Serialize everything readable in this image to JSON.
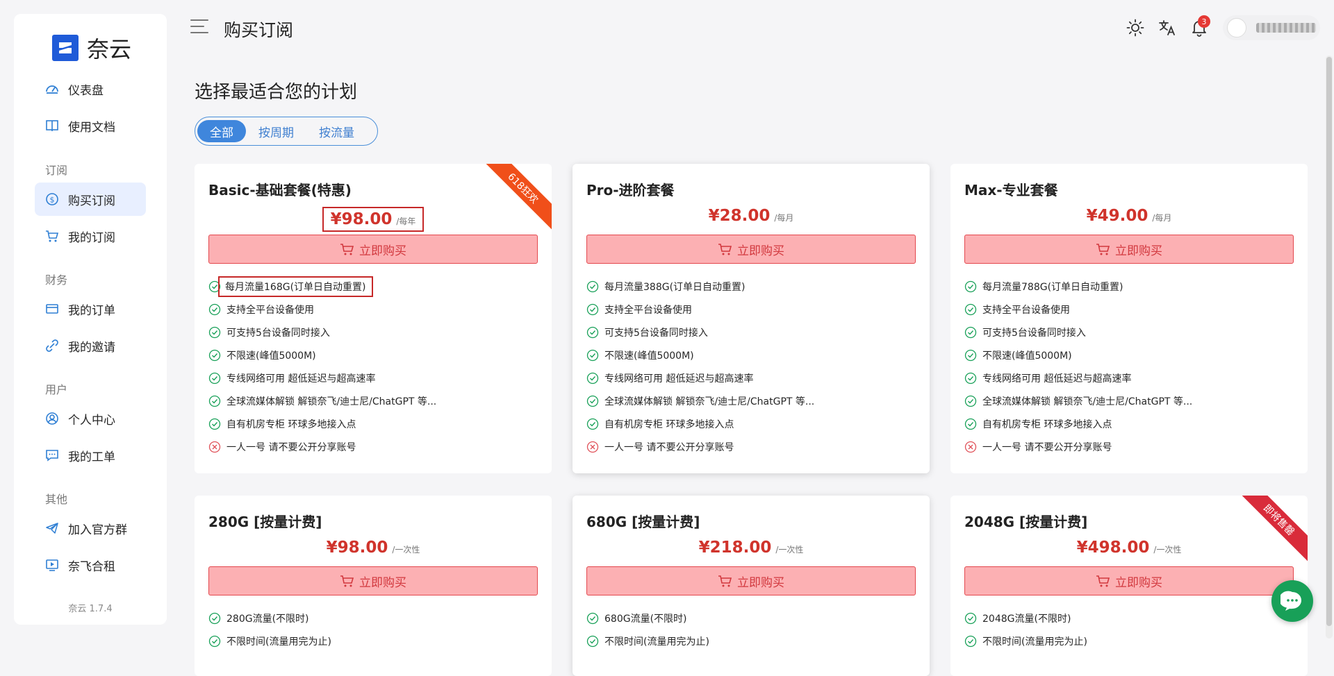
{
  "app": {
    "name": "奈云",
    "version": "奈云 1.7.4"
  },
  "sidebar": {
    "items": [
      {
        "label": "仪表盘",
        "icon": "dashboard-icon"
      },
      {
        "label": "使用文档",
        "icon": "book-icon"
      },
      {
        "group": "订阅"
      },
      {
        "label": "购买订阅",
        "icon": "dollar-icon",
        "active": true
      },
      {
        "label": "我的订阅",
        "icon": "cart-icon"
      },
      {
        "group": "财务"
      },
      {
        "label": "我的订单",
        "icon": "wallet-icon"
      },
      {
        "label": "我的邀请",
        "icon": "share-icon"
      },
      {
        "group": "用户"
      },
      {
        "label": "个人中心",
        "icon": "user-icon"
      },
      {
        "label": "我的工单",
        "icon": "chat-icon"
      },
      {
        "group": "其他"
      },
      {
        "label": "加入官方群",
        "icon": "telegram-icon"
      },
      {
        "label": "奈飞合租",
        "icon": "video-icon"
      }
    ]
  },
  "header": {
    "title": "购买订阅",
    "notification_count": "3"
  },
  "main": {
    "heading": "选择最适合您的计划",
    "tabs": [
      {
        "label": "全部",
        "active": true
      },
      {
        "label": "按周期"
      },
      {
        "label": "按流量"
      }
    ],
    "buy_label": "立即购买",
    "plans": [
      {
        "title": "Basic-基础套餐(特惠)",
        "price": "¥98.00",
        "period": "/每年",
        "ribbon": "618狂欢",
        "features": [
          {
            "text": "每月流量168G(订单日自动重置)",
            "ok": true
          },
          {
            "text": "支持全平台设备使用",
            "ok": true
          },
          {
            "text": "可支持5台设备同时接入",
            "ok": true
          },
          {
            "text": "不限速(峰值5000M)",
            "ok": true
          },
          {
            "text": "专线网络可用 超低延迟与超高速率",
            "ok": true
          },
          {
            "text": "全球流媒体解锁 解锁奈飞/迪士尼/ChatGPT 等...",
            "ok": true
          },
          {
            "text": "自有机房专柜 环球多地接入点",
            "ok": true
          },
          {
            "text": "一人一号 请不要公开分享账号",
            "ok": false
          }
        ]
      },
      {
        "title": "Pro-进阶套餐",
        "price": "¥28.00",
        "period": "/每月",
        "ribbon": "",
        "features": [
          {
            "text": "每月流量388G(订单日自动重置)",
            "ok": true
          },
          {
            "text": "支持全平台设备使用",
            "ok": true
          },
          {
            "text": "可支持5台设备同时接入",
            "ok": true
          },
          {
            "text": "不限速(峰值5000M)",
            "ok": true
          },
          {
            "text": "专线网络可用 超低延迟与超高速率",
            "ok": true
          },
          {
            "text": "全球流媒体解锁 解锁奈飞/迪士尼/ChatGPT 等...",
            "ok": true
          },
          {
            "text": "自有机房专柜 环球多地接入点",
            "ok": true
          },
          {
            "text": "一人一号 请不要公开分享账号",
            "ok": false
          }
        ]
      },
      {
        "title": "Max-专业套餐",
        "price": "¥49.00",
        "period": "/每月",
        "ribbon": "",
        "features": [
          {
            "text": "每月流量788G(订单日自动重置)",
            "ok": true
          },
          {
            "text": "支持全平台设备使用",
            "ok": true
          },
          {
            "text": "可支持5台设备同时接入",
            "ok": true
          },
          {
            "text": "不限速(峰值5000M)",
            "ok": true
          },
          {
            "text": "专线网络可用 超低延迟与超高速率",
            "ok": true
          },
          {
            "text": "全球流媒体解锁 解锁奈飞/迪士尼/ChatGPT 等...",
            "ok": true
          },
          {
            "text": "自有机房专柜 环球多地接入点",
            "ok": true
          },
          {
            "text": "一人一号 请不要公开分享账号",
            "ok": false
          }
        ]
      },
      {
        "title": "280G [按量计费]",
        "price": "¥98.00",
        "period": "/一次性",
        "ribbon": "",
        "features": [
          {
            "text": "280G流量(不限时)",
            "ok": true
          },
          {
            "text": "不限时间(流量用完为止)",
            "ok": true
          }
        ]
      },
      {
        "title": "680G [按量计费]",
        "price": "¥218.00",
        "period": "/一次性",
        "ribbon": "",
        "features": [
          {
            "text": "680G流量(不限时)",
            "ok": true
          },
          {
            "text": "不限时间(流量用完为止)",
            "ok": true
          }
        ]
      },
      {
        "title": "2048G [按量计费]",
        "price": "¥498.00",
        "period": "/一次性",
        "ribbon": "即将售罄",
        "features": [
          {
            "text": "2048G流量(不限时)",
            "ok": true
          },
          {
            "text": "不限时间(流量用完为止)",
            "ok": true
          }
        ]
      }
    ]
  },
  "colors": {
    "accent": "#3f86dc",
    "price": "#d0342c",
    "buy_bg": "#fcb0b3",
    "ok": "#18a058",
    "no": "#e0525a",
    "chat": "#18a058"
  }
}
